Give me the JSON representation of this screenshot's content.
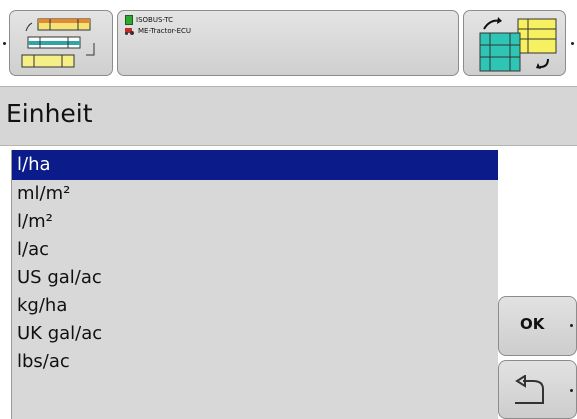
{
  "header": {
    "info": {
      "line1": "ISOBUS-TC",
      "line2": "ME-Tractor-ECU"
    },
    "left_softkey_icon": "job-navigation-icon",
    "right_softkey_icon": "section-switch-icon"
  },
  "page": {
    "title": "Einheit"
  },
  "units": {
    "items": [
      "l/ha",
      "ml/m²",
      "l/m²",
      "l/ac",
      "US gal/ac",
      "kg/ha",
      "UK gal/ac",
      "lbs/ac"
    ],
    "selected": "l/ha"
  },
  "actions": {
    "ok_label": "OK",
    "back_icon": "back-arrow-icon"
  },
  "colors": {
    "selection": "#0b1b8a",
    "list_background": "#d8d8d8",
    "title_background": "#d6d6d6"
  }
}
